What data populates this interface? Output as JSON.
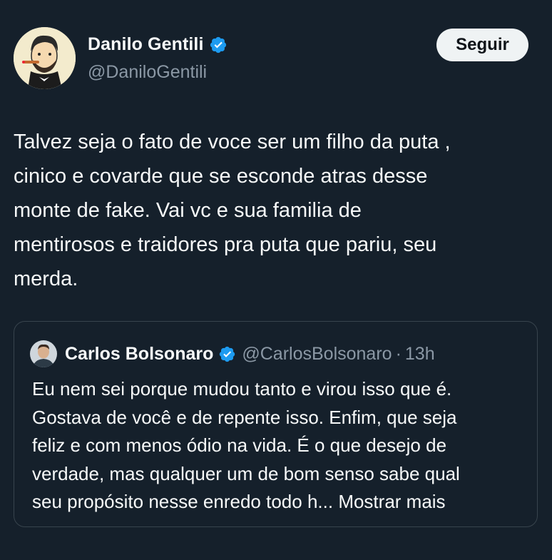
{
  "tweet": {
    "author": {
      "name": "Danilo Gentili",
      "handle": "@DaniloGentili",
      "verified_icon": "verified-badge-icon"
    },
    "follow_label": "Seguir",
    "text": "Talvez seja o fato de voce ser um filho da puta ,\ncinico e covarde que se esconde atras desse\nmonte de fake. Vai vc e sua familia  de\nmentirosos e traidores pra puta que pariu, seu\nmerda."
  },
  "quote": {
    "author": {
      "name": "Carlos Bolsonaro",
      "handle": "@CarlosBolsonaro",
      "verified_icon": "verified-badge-icon"
    },
    "separator": "·",
    "time": "13h",
    "text": "Eu nem sei porque mudou tanto e virou isso que é.\nGostava de você e de repente isso. Enfim, que seja\nfeliz e com menos ódio na vida. É o que desejo de\nverdade, mas qualquer um de bom senso sabe qual\nseu propósito nesse enredo todo h...",
    "show_more_label": "Mostrar mais"
  },
  "colors": {
    "background": "#15202b",
    "text": "#f7f9f9",
    "muted": "#8b98a5",
    "verified": "#1d9bf0",
    "border": "#38444d"
  }
}
